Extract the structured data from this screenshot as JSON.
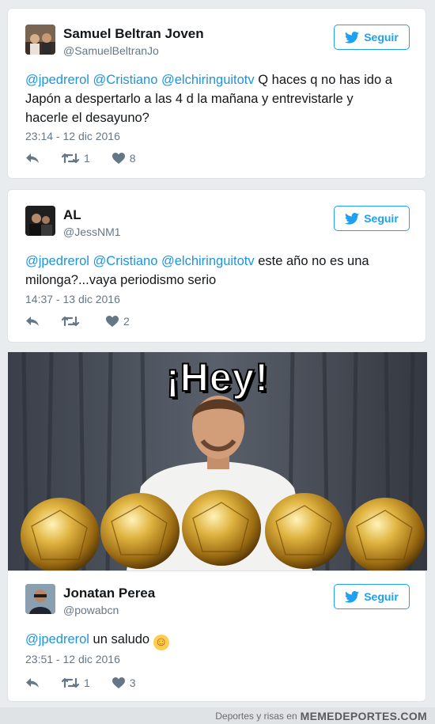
{
  "tweets": [
    {
      "name": "Samuel Beltran Joven",
      "handle": "@SamuelBeltranJo",
      "follow_label": "Seguir",
      "mentions": [
        "@jpedrerol",
        "@Cristiano",
        "@elchiringuitotv"
      ],
      "text_line1_rest": " Q haces q no has ido a",
      "text_line2": "Japón a despertarlo a las 4 d la mañana y entrevistarle y",
      "text_line3": "hacerle el desayuno?",
      "time": "23:14 - 12 dic 2016",
      "retweets": "1",
      "likes": "8"
    },
    {
      "name": "AL",
      "handle": "@JessNM1",
      "follow_label": "Seguir",
      "mentions": [
        "@jpedrerol",
        "@Cristiano",
        "@elchiringuitotv"
      ],
      "text_line1_rest": " este año no es una",
      "text_line2": "milonga?...vaya periodismo serio",
      "time": "14:37 - 13 dic 2016",
      "retweets": "",
      "likes": "2"
    },
    {
      "name": "Jonatan Perea",
      "handle": "@powabcn",
      "follow_label": "Seguir",
      "mentions": [
        "@jpedrerol"
      ],
      "text_rest": " un saludo ",
      "emoji": "☺",
      "time": "23:51 - 12 dic 2016",
      "retweets": "1",
      "likes": "3"
    }
  ],
  "meme": {
    "caption": "¡Hey!"
  },
  "footer": {
    "tagline": "Deportes y risas en",
    "site": "MEMEDEPORTES.COM"
  },
  "colors": {
    "accent": "#1da1f2",
    "mention": "#1b95e0",
    "muted": "#657786"
  }
}
